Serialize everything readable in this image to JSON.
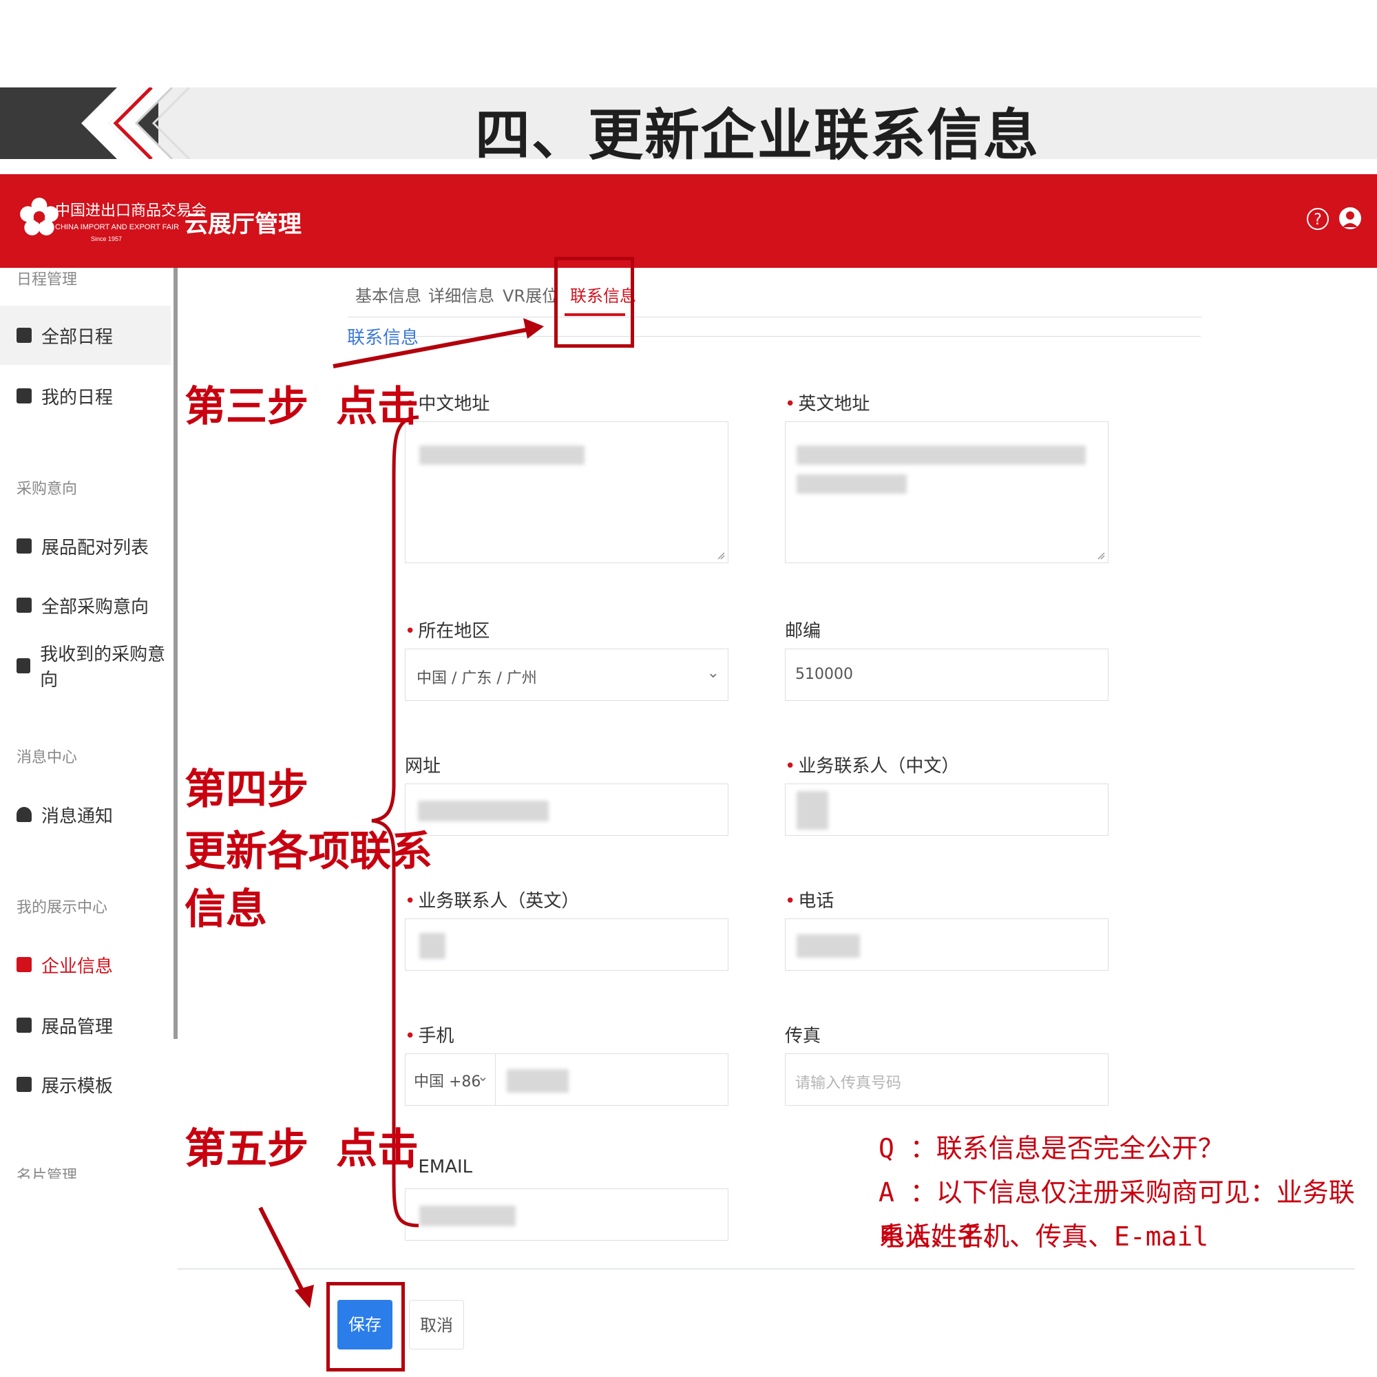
{
  "slide": {
    "title": "四、更新企业联系信息"
  },
  "header": {
    "logo_cn": "中国进出口商品交易会",
    "logo_en": "CHINA IMPORT AND EXPORT FAIR",
    "logo_since": "Since 1957",
    "app_title": "云展厅管理",
    "help_glyph": "?"
  },
  "sidebar": {
    "groups": [
      "日程管理",
      "采购意向",
      "消息中心",
      "我的展示中心",
      "名片管理"
    ],
    "items": [
      {
        "label": "全部日程",
        "icon": "calendar-icon"
      },
      {
        "label": "我的日程",
        "icon": "layers-icon"
      },
      {
        "label": "展品配对列表",
        "icon": "grid-icon"
      },
      {
        "label": "全部采购意向",
        "icon": "list-icon"
      },
      {
        "label": "我收到的采购意向",
        "icon": "inbox-icon"
      },
      {
        "label": "消息通知",
        "icon": "bell-icon"
      },
      {
        "label": "企业信息",
        "icon": "company-icon"
      },
      {
        "label": "展品管理",
        "icon": "grid-icon"
      },
      {
        "label": "展示模板",
        "icon": "template-icon"
      }
    ],
    "active_item": "企业信息"
  },
  "tabs": [
    "基本信息",
    "详细信息",
    "VR展位",
    "联系信息"
  ],
  "active_tab": "联系信息",
  "section_title": "联系信息",
  "form": {
    "cn_address_label": "中文地址",
    "en_address_label": "英文地址",
    "region_label": "所在地区",
    "region_value": "中国 / 广东 / 广州",
    "zip_label": "邮编",
    "zip_value": "510000",
    "website_label": "网址",
    "contact_cn_label": "业务联系人（中文）",
    "contact_en_label": "业务联系人（英文）",
    "phone_label": "电话",
    "mobile_label": "手机",
    "mobile_prefix": "中国 +86",
    "fax_label": "传真",
    "fax_placeholder": "请输入传真号码",
    "email_label": "EMAIL"
  },
  "buttons": {
    "save": "保存",
    "cancel": "取消"
  },
  "annotations": {
    "step3_a": "第三步",
    "step3_b": "点击",
    "step4_line1": "第四步",
    "step4_line2": "更新各项联系",
    "step4_line3": "信息",
    "step5_a": "第五步",
    "step5_b": "点击",
    "qa_q": "Q ：联系信息是否完全公开？",
    "qa_a1": "A ：以下信息仅注册采购商可见：业务联系人姓名、",
    "qa_a2": "电话、手机、传真、E-mail"
  },
  "colors": {
    "brand_red": "#d2111b",
    "annotation_red": "#c8000f",
    "link_blue": "#3a78d8",
    "primary_blue": "#2b7de9"
  }
}
